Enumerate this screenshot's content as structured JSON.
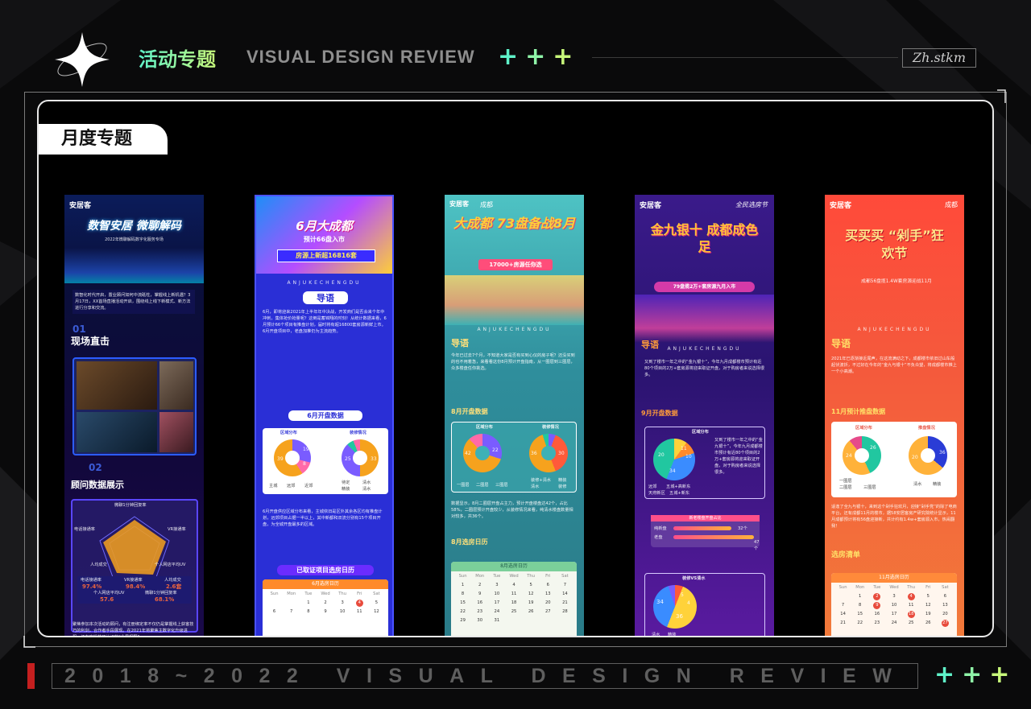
{
  "header": {
    "title_cn": "活动专题",
    "title_en": "VISUAL DESIGN REVIEW",
    "plus_marks": [
      "+",
      "+",
      "+"
    ],
    "signature": "Zh.stkm"
  },
  "section": {
    "tab_label": "月度专题"
  },
  "phones": [
    {
      "logo": "安居客",
      "hero_title": "数智安居 微聊解码",
      "hero_sub": "2022年微聊解码数字化服务专场",
      "intro": "数智化时代开启，置业顾问如何中流砥柱，掌握线上新机遇？3月17日，XX首场直播活动开启，围绕线上线下新模式、新方法进行分享和交流。",
      "sec1_num": "01",
      "sec1_title": "现场直击",
      "sec2_num": "02",
      "sec2_title": "顾问数据展示",
      "radar_labels": [
        "微聊1分钟回复率",
        "VR接通率",
        "个人网店平均UV",
        "人均成交",
        "电话接通率"
      ],
      "stats_labels": [
        "电话接通率",
        "VR接通率",
        "人均成交"
      ],
      "stats_values": [
        "97.4%",
        "98.4%",
        "2.6套"
      ],
      "stats_labels2": [
        "个人网店平均UV",
        "微聊1分钟回复率"
      ],
      "stats_values2": [
        "57.6",
        "68.1%"
      ],
      "footer_text": "聚焦参加本次活动的顾问，有注册绑定率不仅仍是掌握线上获客技巧的利剑，合作者手段展现。在2021年将聚焦主数字化升级进程，还有实操技巧认识的“全局视野”。"
    },
    {
      "banner_line1": "6月大成都",
      "banner_line2": "预计66盘入市",
      "banner_line3": "房源上新超16816套",
      "brand_sub": "ANJUKECHENGDU",
      "guide_title": "导语",
      "guide_text": "6月，即将迎来2021年上半年年中决战，开发商们是否会来个年中冲刺，集体抢价抢量呢？这倒是蓄锦翔的时刻！从统计数据来看，6月预计66个项目有推盘计划，届时将有超16800套房源新鲜上市。6月开盘项目中，老盘加推仍为主流趋势。",
      "chart_title": "6月开盘数据",
      "pie1_title": "区域分布",
      "pie2_title": "装修情况",
      "pie1_values": [
        "39",
        "19",
        "8"
      ],
      "pie2_values": [
        "33",
        "25",
        "4",
        "4"
      ],
      "pie1_legend": [
        "主城",
        "远郊",
        "近郊"
      ],
      "pie2_legend": [
        "待定",
        "清水",
        "精装",
        "清水"
      ],
      "para2": "6月开盘供应区域分布来看，主城依旧是区外其余各区均有推盘计划，远郊项目占据一半以上，其中新都和双流分别有15个项目开盘，为全城开盘最多的区域。",
      "section2_title": "已取证项目选房日历",
      "calendar_title": "6月选房日历",
      "weekdays": [
        "Sun",
        "Mon",
        "Tue",
        "Wed",
        "Thu",
        "Fri",
        "Sat"
      ]
    },
    {
      "logo": "安居客",
      "city": "成都",
      "hero_title": "大成都 73盘备战8月",
      "hero_sub": "17000+房源任你选",
      "brand_sub": "ANJUKECHENGDU",
      "guide_title": "导语",
      "guide_text": "今年已过去7个月，不知道大家是否有买到心仪的房子呢？还没买到的也不用着急，来看看这份8月预计开盘指南，从一圈层到三圈层，众多楼盘任你挑选。",
      "chart_title": "8月开盘数据",
      "pie1_title": "区域分布",
      "pie2_title": "装修情况",
      "pie1_values": [
        "42",
        "22",
        "9"
      ],
      "pie2_values": [
        "36",
        "30",
        "4",
        "3"
      ],
      "pie1_legend": [
        "一圈层",
        "二圈层",
        "三圈层"
      ],
      "pie2_legend": [
        "装修+清水",
        "清水",
        "精装",
        "装修"
      ],
      "para2": "数据显示，8月二圈层开盘占主力，预计开盘楼盘达42个，占比58%，二圈层预计开盘较少，从装修情况来看，纯清水楼盘数量相对较多，共36个。",
      "section2_title": "8月选房日历",
      "calendar_title": "8月选房日历",
      "weekdays": [
        "Sun",
        "Mon",
        "Tue",
        "Wed",
        "Thu",
        "Fri",
        "Sat"
      ]
    },
    {
      "logo": "安居客",
      "badge": "全民选房节",
      "hero_title": "金九银十 成都成色足",
      "hero_sub": "79盘揽2万+套房源九月入市",
      "brand_sub": "ANJUKECHENGDU",
      "guide_title": "导语",
      "guide_text": "又到了楼市一年之中的“金九银十”，今年九月成都楼市预计有近80个项目的2万+套房源将迎来取证开盘，对于购房者来说选择很多。",
      "chart_title": "9月开盘数据",
      "pie1_title": "区域分布",
      "pie1_values": [
        "20",
        "11",
        "10",
        "4",
        "34"
      ],
      "pie1_legend": [
        "远郊",
        "五城+高新东",
        "五城+新东",
        "天府新区",
        "金"
      ],
      "bar_title": "新老楼盘开盘占比",
      "bar_labels": [
        "纯新盘",
        "老盘"
      ],
      "bar_values": [
        "32个",
        "47个"
      ],
      "pie2_title": "装修VS清水",
      "pie2_values": [
        "34",
        "36",
        "5",
        "4"
      ],
      "pie2_legend": [
        "清水",
        "精装"
      ]
    },
    {
      "logo": "安居客",
      "city": "成都",
      "hero_title": "买买买 “剁手”狂欢节",
      "hero_sub": "成都56盘揽1.4W套房源迎战11月",
      "brand_sub": "ANJUKECHENGDU",
      "guide_title": "导语",
      "guide_text": "2021年已逐渐接近尾声，在这流满动之下，成都楼市依旧过山车般起伏波折，不过好在今年的“金九与银十”不负众望，将成都楼市推上一个小高潮。",
      "chart_title": "11月预计推盘数据",
      "pie1_title": "区域分布",
      "pie2_title": "推盘情况",
      "pie1_values": [
        "26",
        "24",
        "6"
      ],
      "pie2_values": [
        "36",
        "20"
      ],
      "pie1_legend": [
        "一圈层",
        "二圈层",
        "三圈层"
      ],
      "pie2_legend": [
        "清水",
        "精装"
      ],
      "para2": "适逢了全九与银十，来到这个剁手狂欢月，迎接“剁手党”的除了电商平台，还有成都11月的楼市，据58安居客房产研究院统计显示，11月成都预计将有56盘迎接新，共计约有1.4w+套房源入市，热闹翻我！",
      "section2_title": "选房清单",
      "calendar_title": "11月选房日历",
      "weekdays": [
        "Sun",
        "Mon",
        "Tue",
        "Wed",
        "Thu",
        "Fri",
        "Sat"
      ]
    }
  ],
  "footer": {
    "text": "2018~2022 VISUAL DESIGN REVIEW",
    "plus_marks": [
      "+",
      "+",
      "+"
    ]
  },
  "colors": {
    "accent_teal": "#5ff2c9",
    "accent_lime": "#c7f77a",
    "footer_red": "#c41f1f"
  }
}
